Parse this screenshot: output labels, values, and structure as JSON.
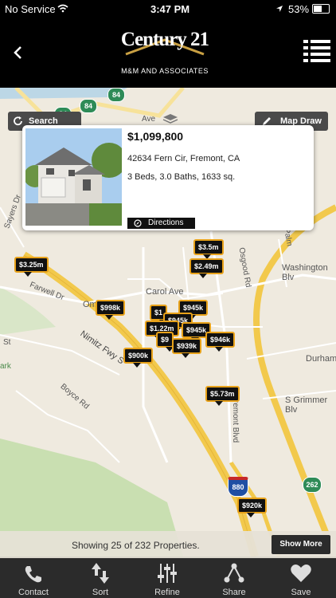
{
  "status": {
    "carrier": "No Service",
    "time": "3:47 PM",
    "battery": "53%"
  },
  "brand": {
    "name": "Century 21",
    "subtitle": "M&M AND ASSOCIATES"
  },
  "map": {
    "search_again": "Search Again",
    "map_draw": "Map Draw",
    "streets": [
      "Carol Ave",
      "Washington Blv",
      "Farwell Dr",
      "Nimitz Fwy S",
      "Boyce Rd",
      "Fremont Blvd",
      "Osgood Rd",
      "Durham",
      "S Grimmer Blv",
      "Sayers Dr",
      "Palm",
      "St",
      "Ave",
      "Om",
      "ark"
    ],
    "highways": [
      "84",
      "84",
      "880",
      "262"
    ],
    "pins": [
      "$3.25m",
      "$3.5m",
      "$2.49m",
      "$998k",
      "$945k",
      "$1.22m",
      "$939k",
      "$946k",
      "$900k",
      "$5.73m",
      "$920k",
      "$1",
      "$9"
    ]
  },
  "listing": {
    "price": "$1,099,800",
    "address": "42634 Fern Cir, Fremont, CA",
    "details": "3 Beds, 3.0 Baths, 1633 sq.",
    "directions": "Directions"
  },
  "footer": {
    "showing": "Showing 25 of 232 Properties.",
    "show_more": "Show More"
  },
  "tabs": [
    {
      "label": "Contact",
      "icon": "phone-icon"
    },
    {
      "label": "Sort",
      "icon": "sort-arrows-icon"
    },
    {
      "label": "Refine",
      "icon": "sliders-icon"
    },
    {
      "label": "Share",
      "icon": "share-icon"
    },
    {
      "label": "Save",
      "icon": "heart-icon"
    }
  ]
}
